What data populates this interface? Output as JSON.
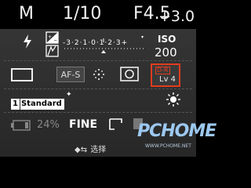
{
  "top": {
    "mode": "M",
    "shutter": "1/10",
    "aperture": "F4.5",
    "exposure_comp": "+3.0"
  },
  "exposure_scale": {
    "labels": [
      "-3",
      "2",
      "1",
      "0",
      "1",
      "2",
      "3+"
    ]
  },
  "iso": {
    "label": "ISO",
    "value": "200"
  },
  "row2": {
    "af_mode": "AF-S",
    "dro_label": "D-R",
    "dro_value": "Lv 4"
  },
  "creative_style": {
    "number": "1",
    "name": "Standard"
  },
  "bottom_row": {
    "battery_pct": "24%",
    "quality": "FINE"
  },
  "hint": {
    "arrows": "◆⇆",
    "text": "选择"
  },
  "watermark": {
    "main": "PCHOME",
    "url": "WWW.PCHOME.NET"
  },
  "colors": {
    "accent": "#e23c1e",
    "panel": "#2d2d2d",
    "background": "#000000"
  },
  "icons": [
    "flash-icon",
    "exposure-comp-icon",
    "drive-mode-icon",
    "af-area-icon",
    "metering-icon",
    "white-balance-icon",
    "battery-icon",
    "aspect-ratio-icon"
  ]
}
